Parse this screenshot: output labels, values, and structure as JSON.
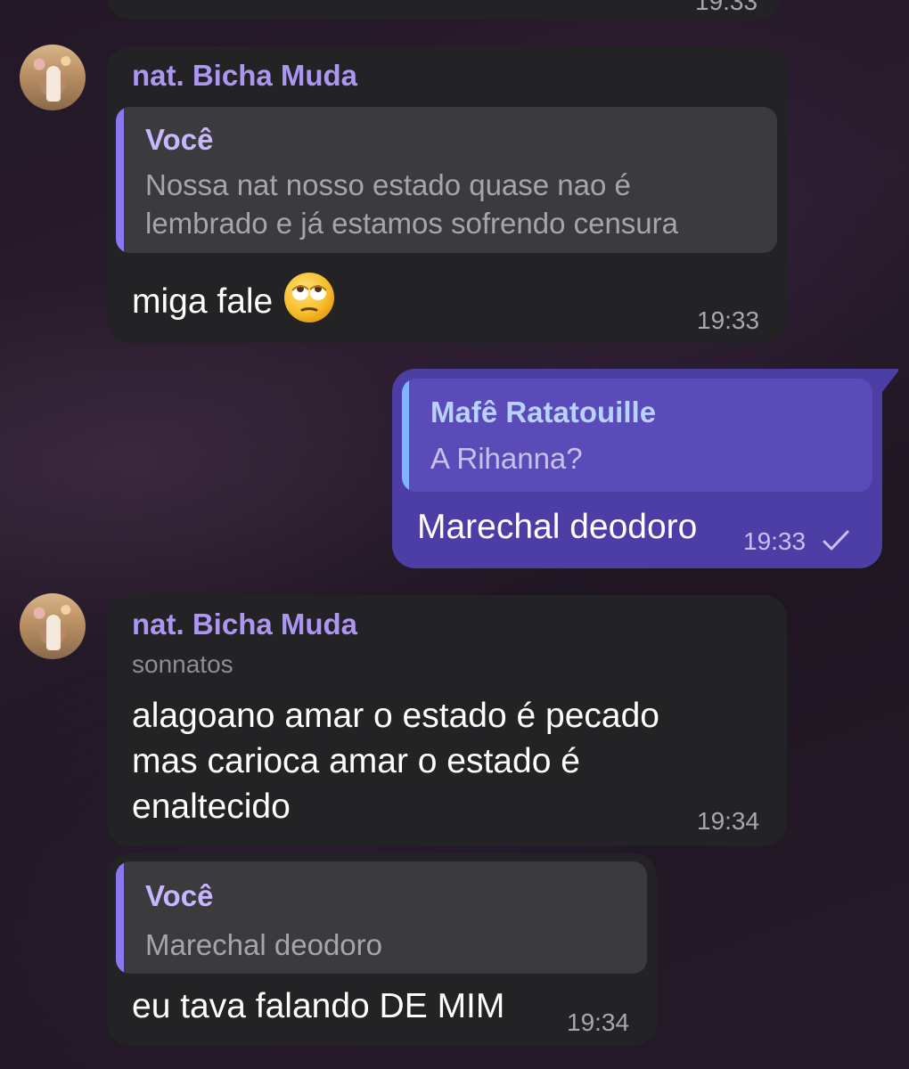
{
  "top_partial_time": "19:33",
  "messages": [
    {
      "sender": "nat. Bicha Muda",
      "reply": {
        "name": "Você",
        "text_line1": "Nossa nat nosso estado quase nao é",
        "text_line2": "lembrado e já estamos sofrendo censura"
      },
      "text": "miga fale",
      "emoji": "face-with-rolling-eyes",
      "time": "19:33"
    },
    {
      "reply": {
        "name": "Mafê Ratatouille",
        "text": "A Rihanna?"
      },
      "text": "Marechal deodoro",
      "time": "19:33",
      "status": "sent-check-icon"
    },
    {
      "sender": "nat. Bicha Muda",
      "subline": "sonnatos",
      "text_line1": "alagoano amar o estado é pecado",
      "text_line2": "mas carioca amar o estado é",
      "text_line3": "enaltecido",
      "time": "19:34"
    },
    {
      "reply": {
        "name": "Você",
        "text": "Marechal deodoro"
      },
      "text": "eu tava falando DE MIM",
      "time": "19:34"
    }
  ],
  "colors": {
    "incoming_bubble": "#232224",
    "outgoing_bubble": "#4d3ea6",
    "sender_name": "#ad96f2",
    "quote_bar": "#8b78f0"
  }
}
